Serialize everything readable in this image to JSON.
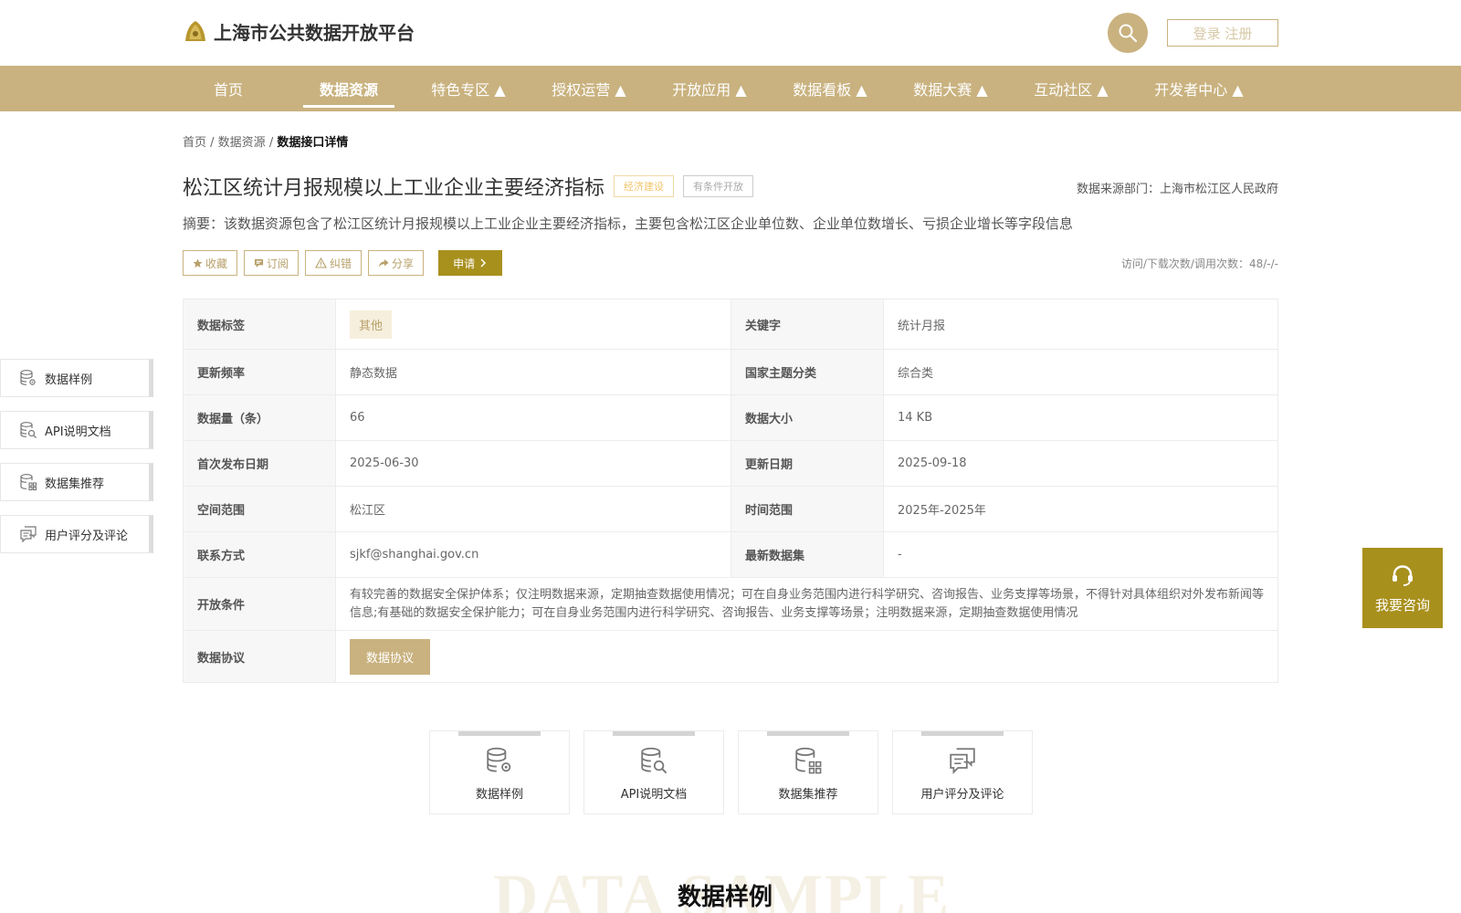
{
  "header": {
    "logo_text": "上海市公共数据开放平台",
    "login_label": "登录 注册"
  },
  "nav": [
    {
      "label": "首页"
    },
    {
      "label": "数据资源"
    },
    {
      "label": "特色专区 ▲"
    },
    {
      "label": "授权运营 ▲"
    },
    {
      "label": "开放应用 ▲"
    },
    {
      "label": "数据看板 ▲"
    },
    {
      "label": "数据大赛 ▲"
    },
    {
      "label": "互动社区 ▲"
    },
    {
      "label": "开发者中心 ▲"
    }
  ],
  "breadcrumb": {
    "home": "首页",
    "sep1": " / ",
    "level2": "数据资源",
    "sep2": " / ",
    "current": "数据接口详情"
  },
  "dataset": {
    "title": "松江区统计月报规模以上工业企业主要经济指标",
    "tag_domain": "经济建设",
    "tag_open": "有条件开放",
    "source": "数据来源部门：上海市松江区人民政府",
    "summary": "摘要：该数据资源包含了松江区统计月报规模以上工业企业主要经济指标，主要包含松江区企业单位数、企业单位数增长、亏损企业增长等字段信息",
    "stats": "访问/下载次数/调用次数：48/-/-"
  },
  "actions": {
    "favorite": "收藏",
    "subscribe": "订阅",
    "report": "纠错",
    "share": "分享",
    "apply": "申请"
  },
  "info": {
    "tag_label": "数据标签",
    "tag_value": "其他",
    "keyword_label": "关键字",
    "keyword_value": "统计月报",
    "freq_label": "更新频率",
    "freq_value": "静态数据",
    "theme_label": "国家主题分类",
    "theme_value": "综合类",
    "count_label": "数据量（条）",
    "count_value": "66",
    "size_label": "数据大小",
    "size_value": "14 KB",
    "first_label": "首次发布日期",
    "first_value": "2025-06-30",
    "updated_label": "更新日期",
    "updated_value": "2025-09-18",
    "space_label": "空间范围",
    "space_value": "松江区",
    "time_label": "时间范围",
    "time_value": "2025年-2025年",
    "contact_label": "联系方式",
    "contact_value": "sjkf@shanghai.gov.cn",
    "latest_label": "最新数据集",
    "latest_value": "-",
    "cond_label": "开放条件",
    "cond_value": "有较完善的数据安全保护体系；仅注明数据来源，定期抽查数据使用情况；可在自身业务范围内进行科学研究、咨询报告、业务支撑等场景，不得针对具体组织对外发布新闻等信息;有基础的数据安全保护能力；可在自身业务范围内进行科学研究、咨询报告、业务支撑等场景；注明数据来源，定期抽查数据使用情况",
    "protocol_label": "数据协议",
    "protocol_button": "数据协议"
  },
  "side_nav": [
    {
      "label": "数据样例",
      "icon": "database-gear-icon"
    },
    {
      "label": "API说明文档",
      "icon": "database-search-icon"
    },
    {
      "label": "数据集推荐",
      "icon": "database-grid-icon"
    },
    {
      "label": "用户评分及评论",
      "icon": "comment-icon"
    }
  ],
  "consult": {
    "label": "我要咨询"
  },
  "cards": [
    {
      "label": "数据样例"
    },
    {
      "label": "API说明文档"
    },
    {
      "label": "数据集推荐"
    },
    {
      "label": "用户评分及评论"
    }
  ],
  "section": {
    "bg_text": "DATA SAMPLE",
    "title": "数据样例"
  },
  "colors": {
    "brand": "#c9b27f",
    "apply": "#a8901d"
  }
}
